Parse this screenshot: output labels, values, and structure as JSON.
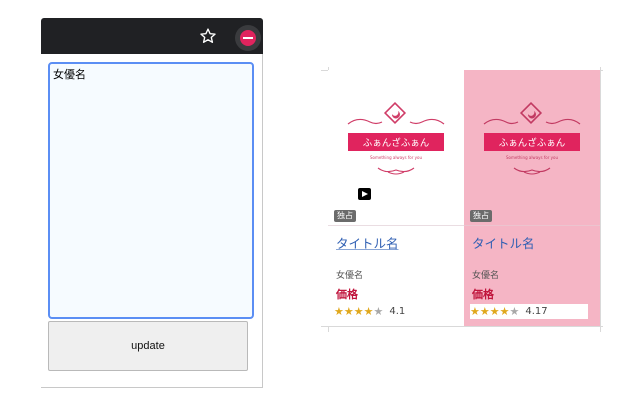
{
  "popup": {
    "textarea_value": "女優名",
    "update_label": "update"
  },
  "preview": {
    "cards": [
      {
        "logo_text": "ふぁんざふぁん",
        "logo_tagline": "Something always for you",
        "badge": "独占",
        "title": "タイトル名",
        "actress": "女優名",
        "price": "価格",
        "rating_value": "4.1",
        "stars_filled": 4,
        "stars_total": 5,
        "has_play_icon": true,
        "background": "#ffffff"
      },
      {
        "logo_text": "ふぁんざふぁん",
        "logo_tagline": "Something always for you",
        "badge": "独占",
        "title": "タイトル名",
        "actress": "女優名",
        "price": "価格",
        "rating_value": "4.17",
        "stars_filled": 4,
        "stars_total": 5,
        "has_play_icon": false,
        "background": "#f5b5c5"
      }
    ]
  },
  "colors": {
    "toolbar": "#202124",
    "focus_border": "#5b8ef4",
    "brand_red": "#e0245e",
    "price_red": "#c0143c",
    "link_blue": "#2f5fb3",
    "highlight_pink": "#f5b5c5"
  },
  "icons": [
    "star-outline-icon",
    "extension-icon",
    "play-icon",
    "rating-star-icon"
  ]
}
